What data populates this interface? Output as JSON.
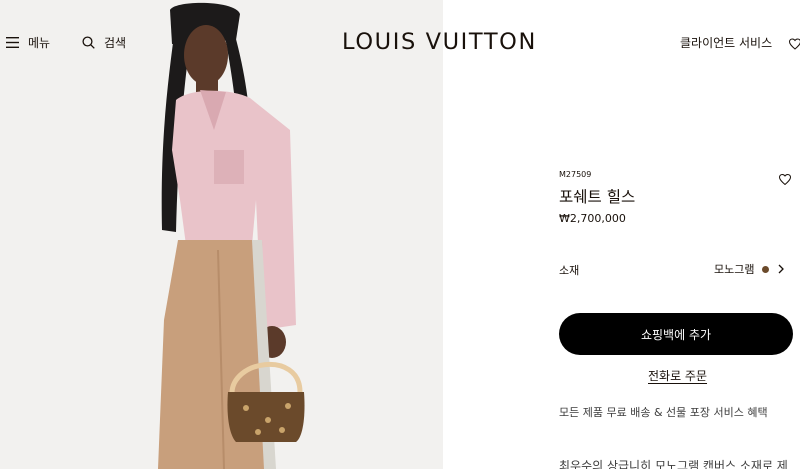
{
  "header": {
    "menu_label": "메뉴",
    "search_label": "검색",
    "logo_text": "LOUIS VUITTON",
    "client_service_label": "클라이언트 서비스"
  },
  "product": {
    "sku": "M27509",
    "name": "포쉐트 힐스",
    "price": "₩2,700,000",
    "material_label": "소재",
    "material_value": "모노그램",
    "add_to_cart_label": "쇼핑백에 추가",
    "phone_order_label": "전화로 주문",
    "benefits_text": "모든 제품 무료 배송 & 선물 포장 서비스 혜택",
    "partial_text": "최우수의 상급니히 모노그램 캔버스 소재로 제"
  },
  "colors": {
    "text": "#19110b",
    "button_bg": "#000000",
    "material_swatch": "#6b4a2b",
    "hero_bg": "#f2f1ef"
  },
  "icons": {
    "menu": "hamburger-icon",
    "search": "search-icon",
    "wishlist": "heart-icon",
    "material_arrow": "chevron-right-icon"
  }
}
